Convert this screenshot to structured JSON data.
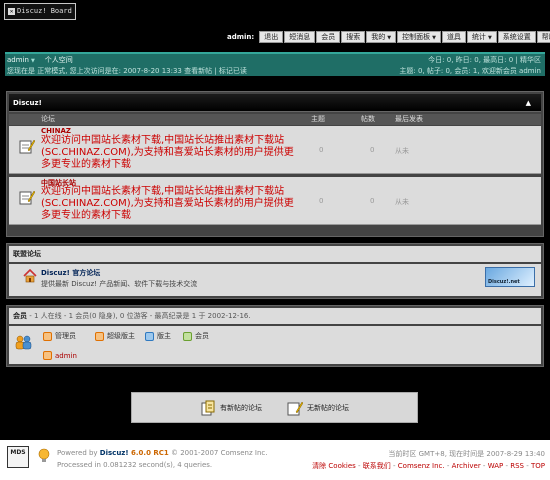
{
  "logo": {
    "text": "Discuz! Board"
  },
  "topmenu": {
    "username": "admin:",
    "items": [
      "退出",
      "短消息",
      "会员",
      "搜索",
      "我的",
      "控制面板",
      "道具",
      "统计",
      "系统设置",
      "帮助"
    ]
  },
  "status": {
    "user": "admin",
    "space_link": "个人空间",
    "line2": "您现在是 正常模式, 您上次访问是在: 2007-8-20 13:33 查看新帖 | 标记已读",
    "stats1": "今日: 0, 昨日: 0, 最高日: 0 | 精华区",
    "stats2": "主题: 0, 帖子: 0, 会员: 1, 欢迎新会员 admin"
  },
  "forum_box": {
    "title": "Discuz!",
    "collapse": "▲",
    "columns": {
      "forum": "论坛",
      "topics": "主题",
      "posts": "帖数",
      "last": "最后发表"
    },
    "rows": [
      {
        "name": "CHINAZ",
        "desc": "欢迎访问中国站长素材下载,中国站长站推出素材下载站(SC.CHINAZ.COM),为支持和喜爱站长素材的用户提供更多更专业的素材下载",
        "topics": "0",
        "posts": "0",
        "last": "从未"
      },
      {
        "name": "中国站长站",
        "desc": "欢迎访问中国站长素材下载,中国站长站推出素材下载站(SC.CHINAZ.COM),为支持和喜爱站长素材的用户提供更多更专业的素材下载",
        "topics": "0",
        "posts": "0",
        "last": "从未"
      }
    ]
  },
  "alliance": {
    "title": "联盟论坛",
    "name": "Discuz! 官方论坛",
    "desc": "提供最新 Discuz! 产品新闻、软件下载与技术交流",
    "banner": "Discuz!.net"
  },
  "members": {
    "title_bold": "会员",
    "title_rest": " - 1 人在线 - 1 会员(0 隐身), 0 位游客 - 最高纪录是 1 于 2002-12-16.",
    "legend": [
      "管理员",
      "超级版主",
      "版主",
      "会员"
    ],
    "online_user": "admin",
    "colors": {
      "admin": "#e07000",
      "super": "#e07000",
      "mod": "#2f79c0",
      "member": "#6aa030"
    }
  },
  "legendbox": {
    "new_posts": "有新帖的论坛",
    "no_new": "无新帖的论坛"
  },
  "footer": {
    "mds_top": "MDS",
    "mds_bottom": "",
    "powered_prefix": "Powered by ",
    "powered_brand": "Discuz!",
    "powered_ver": " 6.0.0 RC1",
    "powered_rest": " © 2001-2007 Comsenz Inc.",
    "processed": "Processed in 0.081232 second(s), 4 queries.",
    "timezone": "当前时区 GMT+8, 现在时间是 2007-8-29 13:40",
    "links": [
      "清除 Cookies",
      "联系我们",
      "Comsenz Inc.",
      "Archiver",
      "WAP",
      "RSS",
      "TOP"
    ]
  }
}
